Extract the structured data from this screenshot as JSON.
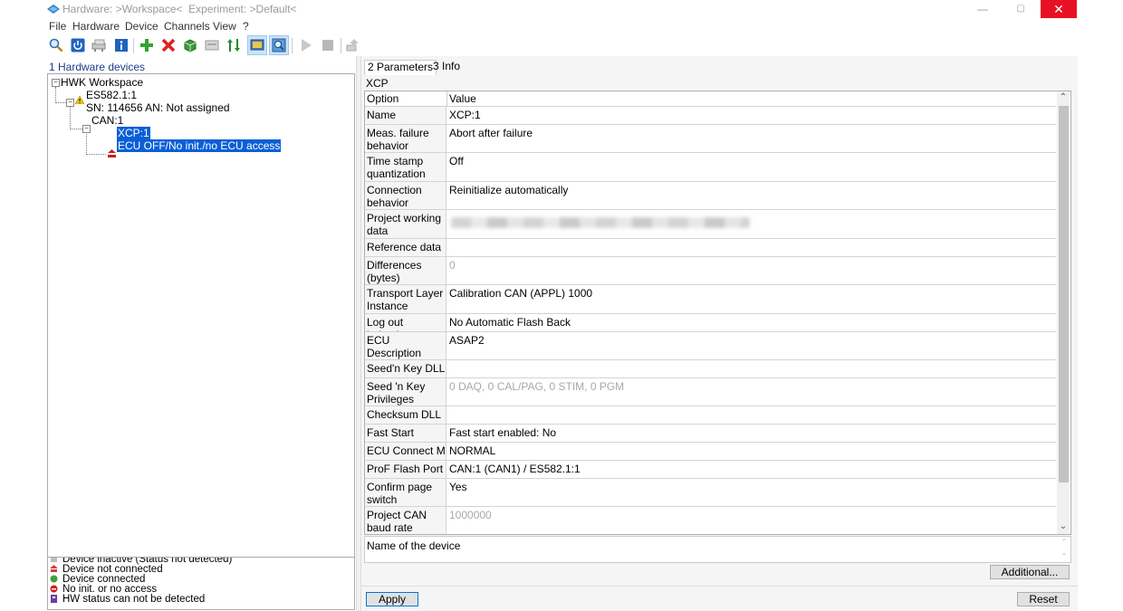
{
  "window": {
    "title": "Hardware: >Workspace<  Experiment: >Default<",
    "controls": {
      "minimize": "—",
      "maximize": "▢",
      "close": "✕"
    }
  },
  "menu": [
    "File",
    "Hardware",
    "Device",
    "Channels",
    "View",
    "?"
  ],
  "toolbar": {
    "icons": [
      "search-icon",
      "power-icon",
      "network-icon",
      "info-icon",
      "add-icon",
      "delete-icon",
      "package-icon",
      "device-icon",
      "sort-icon",
      "monitor-icon",
      "find-hardware-icon",
      "play-icon",
      "stop-icon",
      "flash-icon"
    ]
  },
  "left_panel": {
    "title": "1 Hardware devices",
    "tree": {
      "root": "HWK Workspace",
      "device": "ES582.1:1",
      "device_sn": "SN: 114656 AN: Not assigned",
      "channel": "CAN:1",
      "module": "XCP:1",
      "module_status": "ECU OFF/No init./no ECU access"
    },
    "legend": [
      {
        "label": "Device inactive (Status not detected)",
        "color": "#9a9a9a"
      },
      {
        "label": "Device not connected",
        "color": "#d83b3b"
      },
      {
        "label": "Device connected",
        "color": "#3da23d"
      },
      {
        "label": "No init. or no access",
        "color": "#d81b1b"
      },
      {
        "label": "HW status can not be detected",
        "color": "#6a3fa0"
      }
    ]
  },
  "right_panel": {
    "tabs": [
      "2 Parameters",
      "3 Info"
    ],
    "section": "XCP",
    "grid_headers": {
      "option": "Option",
      "value": "Value"
    },
    "rows": [
      {
        "option": "Name",
        "value": "XCP:1"
      },
      {
        "option": "Meas. failure behavior",
        "value": "Abort after failure"
      },
      {
        "option": "Time stamp quantization",
        "value": "Off"
      },
      {
        "option": "Connection behavior",
        "value": "Reinitialize automatically"
      },
      {
        "option": "Project working data",
        "value": ""
      },
      {
        "option": "Reference data",
        "value": ""
      },
      {
        "option": "Differences (bytes)",
        "value": "0"
      },
      {
        "option": "Transport Layer Instance",
        "value": "Calibration CAN (APPL) 1000"
      },
      {
        "option": "Log out behavior",
        "value": "No Automatic Flash Back"
      },
      {
        "option": "ECU Description Handling",
        "value": "ASAP2"
      },
      {
        "option": "Seed'n Key DLL",
        "value": ""
      },
      {
        "option": "Seed 'n Key Privileges",
        "value": "0 DAQ, 0 CAL/PAG, 0 STIM, 0 PGM"
      },
      {
        "option": "Checksum DLL",
        "value": ""
      },
      {
        "option": "Fast Start",
        "value": "Fast start enabled: No"
      },
      {
        "option": "ECU Connect Mode",
        "value": "NORMAL"
      },
      {
        "option": "ProF Flash Port",
        "value": "CAN:1 (CAN1) / ES582.1:1"
      },
      {
        "option": "Confirm page switch",
        "value": "Yes"
      },
      {
        "option": "Project CAN baud rate [Baud]",
        "value": "1000000"
      }
    ],
    "description": "Name of the device",
    "buttons": {
      "additional": "Additional...",
      "apply": "Apply",
      "reset": "Reset"
    }
  }
}
